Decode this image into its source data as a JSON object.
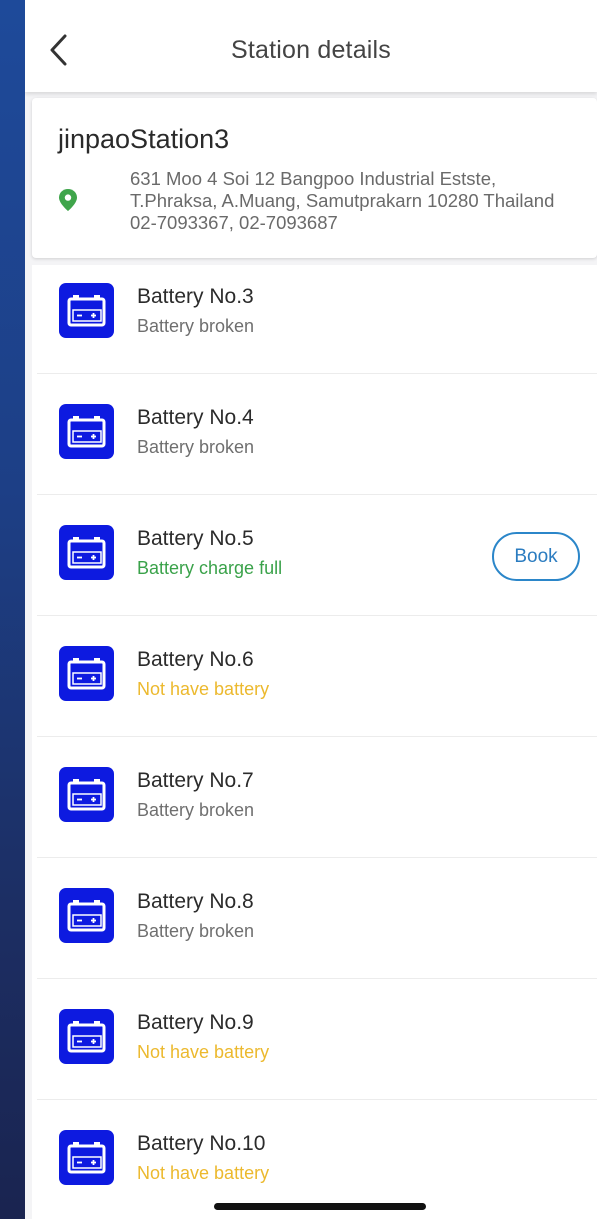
{
  "header": {
    "title": "Station details",
    "back_icon": "chevron-left-icon"
  },
  "station": {
    "name": "jinpaoStation3",
    "address": "631 Moo 4 Soi 12 Bangpoo Industrial Estste, T.Phraksa, A.Muang, Samutprakarn 10280 Thailand 02-7093367, 02-7093687",
    "pin_icon": "location-pin-icon",
    "pin_color": "#3fa54b"
  },
  "batteries": [
    {
      "label": "Battery No.3",
      "status": "Battery broken",
      "status_type": "broken"
    },
    {
      "label": "Battery No.4",
      "status": "Battery broken",
      "status_type": "broken"
    },
    {
      "label": "Battery No.5",
      "status": "Battery charge full",
      "status_type": "full",
      "action": "Book"
    },
    {
      "label": "Battery No.6",
      "status": "Not have battery",
      "status_type": "none"
    },
    {
      "label": "Battery No.7",
      "status": "Battery broken",
      "status_type": "broken"
    },
    {
      "label": "Battery No.8",
      "status": "Battery broken",
      "status_type": "broken"
    },
    {
      "label": "Battery No.9",
      "status": "Not have battery",
      "status_type": "none"
    },
    {
      "label": "Battery No.10",
      "status": "Not have battery",
      "status_type": "none"
    }
  ],
  "colors": {
    "icon_bg": "#0d1ae0",
    "status_broken": "#6f6f6f",
    "status_full": "#3aa24a",
    "status_none": "#ecb92e",
    "book_border": "#2b86c9"
  }
}
